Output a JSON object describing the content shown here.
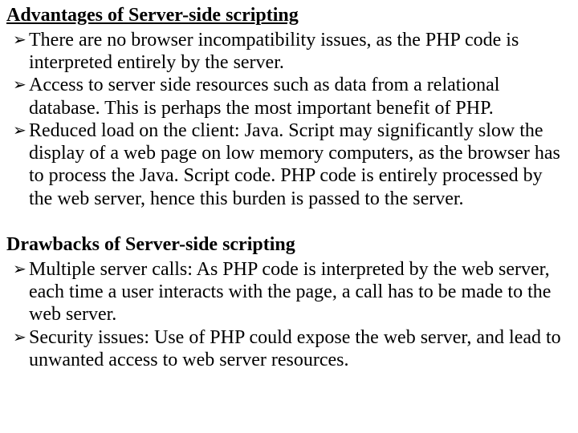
{
  "section1": {
    "heading": "Advantages of Server-side scripting",
    "items": [
      "There are no browser incompatibility issues, as the PHP code is interpreted entirely by the server.",
      "Access to server side resources such as data from a relational database. This is perhaps the most important benefit of PHP.",
      "Reduced load on the client: Java. Script may significantly slow the display of a web page on low memory computers, as the browser has to process the Java. Script code. PHP code is entirely processed by the web server, hence this burden is passed to the server."
    ]
  },
  "section2": {
    "heading": "Drawbacks of Server-side scripting",
    "items": [
      "Multiple server calls: As PHP code is interpreted by the web server, each time a user interacts with the page, a call has to be made to the web server.",
      "Security issues: Use of PHP could expose the web server, and lead to unwanted access to web server resources."
    ]
  }
}
